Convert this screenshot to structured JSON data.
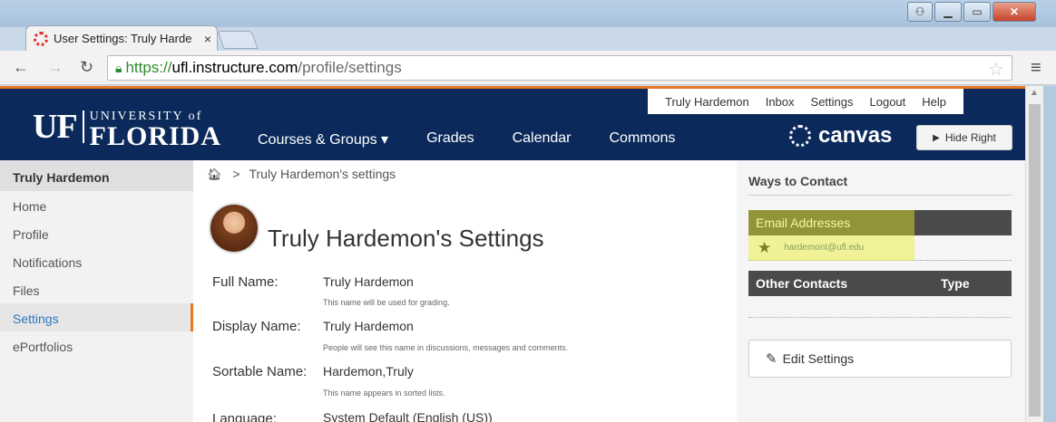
{
  "browser": {
    "tab_title": "User Settings: Truly Harde",
    "tab_close": "×",
    "url_secure": "https://",
    "url_host": "ufl.instructure.com",
    "url_path": "/profile/settings"
  },
  "header": {
    "logo_uf": "UF",
    "logo_univ": "UNIVERSITY of",
    "logo_florida": "FLORIDA",
    "user_links": [
      "Truly Hardemon",
      "Inbox",
      "Settings",
      "Logout",
      "Help"
    ],
    "nav": [
      "Courses & Groups ▾",
      "Grades",
      "Calendar",
      "Commons"
    ],
    "canvas_label": "canvas",
    "hide_right": "Hide Right",
    "accent_color": "#e87722",
    "brand_color": "#0b2a5b"
  },
  "sidebar": {
    "title": "Truly Hardemon",
    "items": [
      {
        "label": "Home"
      },
      {
        "label": "Profile"
      },
      {
        "label": "Notifications"
      },
      {
        "label": "Files"
      },
      {
        "label": "Settings"
      },
      {
        "label": "ePortfolios"
      }
    ],
    "active_item": "Settings"
  },
  "breadcrumb": {
    "current": "Truly Hardemon's settings"
  },
  "main": {
    "title": "Truly Hardemon's Settings",
    "fields": [
      {
        "label": "Full Name:",
        "value": "Truly Hardemon",
        "note": "This name will be used for grading."
      },
      {
        "label": "Display Name:",
        "value": "Truly Hardemon",
        "note": "People will see this name in discussions, messages and comments."
      },
      {
        "label": "Sortable Name:",
        "value": "Hardemon,Truly",
        "note": "This name appears in sorted lists."
      },
      {
        "label": "Language:",
        "value": "System Default (English (US))"
      }
    ]
  },
  "right": {
    "title": "Ways to Contact",
    "email_header": "Email Addresses",
    "email": "hardemont@ufl.edu",
    "other_contacts": "Other Contacts",
    "type_label": "Type",
    "edit_settings": "Edit Settings",
    "highlight_color": "#eef028"
  }
}
